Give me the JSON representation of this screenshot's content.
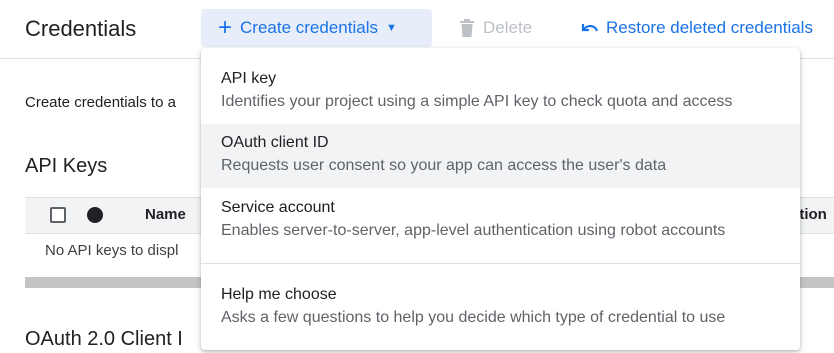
{
  "header": {
    "title": "Credentials",
    "create_label": "Create credentials",
    "delete_label": "Delete",
    "restore_label": "Restore deleted credentials"
  },
  "intro_text": "Create credentials to a",
  "api_keys": {
    "heading": "API Keys",
    "columns": {
      "name": "Name",
      "truncated_right": "ation"
    },
    "empty_text": "No API keys to displ"
  },
  "oauth_heading": "OAuth 2.0 Client I",
  "menu": {
    "items": [
      {
        "title": "API key",
        "description": "Identifies your project using a simple API key to check quota and access"
      },
      {
        "title": "OAuth client ID",
        "description": "Requests user consent so your app can access the user's data"
      },
      {
        "title": "Service account",
        "description": "Enables server-to-server, app-level authentication using robot accounts"
      },
      {
        "title": "Help me choose",
        "description": "Asks a few questions to help you decide which type of credential to use"
      }
    ]
  },
  "colors": {
    "accent": "#1a73e8",
    "button_bg": "#e8eef9",
    "highlight": "#f1f3f4"
  }
}
